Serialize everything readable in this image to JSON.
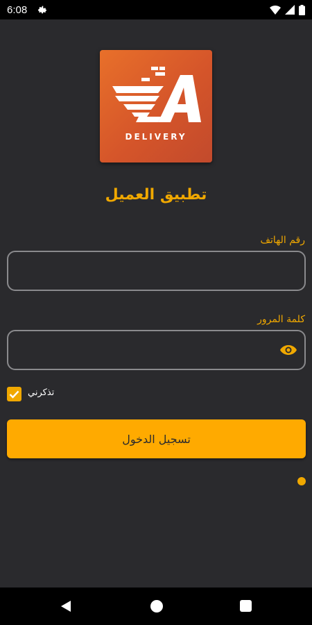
{
  "status_bar": {
    "time": "6:08",
    "icons": [
      "settings-icon",
      "wifi-icon",
      "signal-icon",
      "battery-icon"
    ]
  },
  "logo": {
    "text": "DELIVERY",
    "colors": {
      "start": "#e8702a",
      "end": "#c24a2c"
    }
  },
  "app_title": "تطبيق العميل",
  "form": {
    "phone_label": "رقم الهاتف",
    "phone_value": "",
    "password_label": "كلمة المرور",
    "password_value": "",
    "remember_label": "تذكرني",
    "remember_checked": true,
    "login_button": "تسجيل الدخول"
  },
  "colors": {
    "accent": "#f0a800",
    "button": "#ffaa00",
    "background": "#2a2a2d",
    "field_border": "#8a8a8d"
  },
  "nav_bar": {
    "icons": [
      "back-icon",
      "home-icon",
      "recent-apps-icon"
    ]
  }
}
